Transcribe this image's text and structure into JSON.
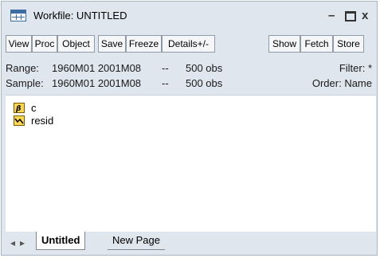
{
  "window": {
    "title": "Workfile: UNTITLED"
  },
  "toolbar": {
    "buttons": [
      "View",
      "Proc",
      "Object",
      "Save",
      "Freeze",
      "Details+/-",
      "Show",
      "Fetch",
      "Store"
    ]
  },
  "info": {
    "range_label": "Range:",
    "range_value": "1960M01 2001M08",
    "range_sep": "--",
    "range_obs": "500 obs",
    "filter_text": "Filter: *",
    "sample_label": "Sample:",
    "sample_value": "1960M01 2001M08",
    "sample_sep": "--",
    "sample_obs": "500 obs",
    "order_text": "Order: Name"
  },
  "objects": [
    {
      "name": "c",
      "icon": "beta-coefficient-icon"
    },
    {
      "name": "resid",
      "icon": "series-line-icon"
    }
  ],
  "tabs": [
    {
      "label": "Untitled",
      "active": true
    },
    {
      "label": "New Page",
      "active": false
    }
  ],
  "colors": {
    "window_bg": "#dfe6ee",
    "icon_yellow": "#ffd84d",
    "border": "#a7b4c3"
  }
}
